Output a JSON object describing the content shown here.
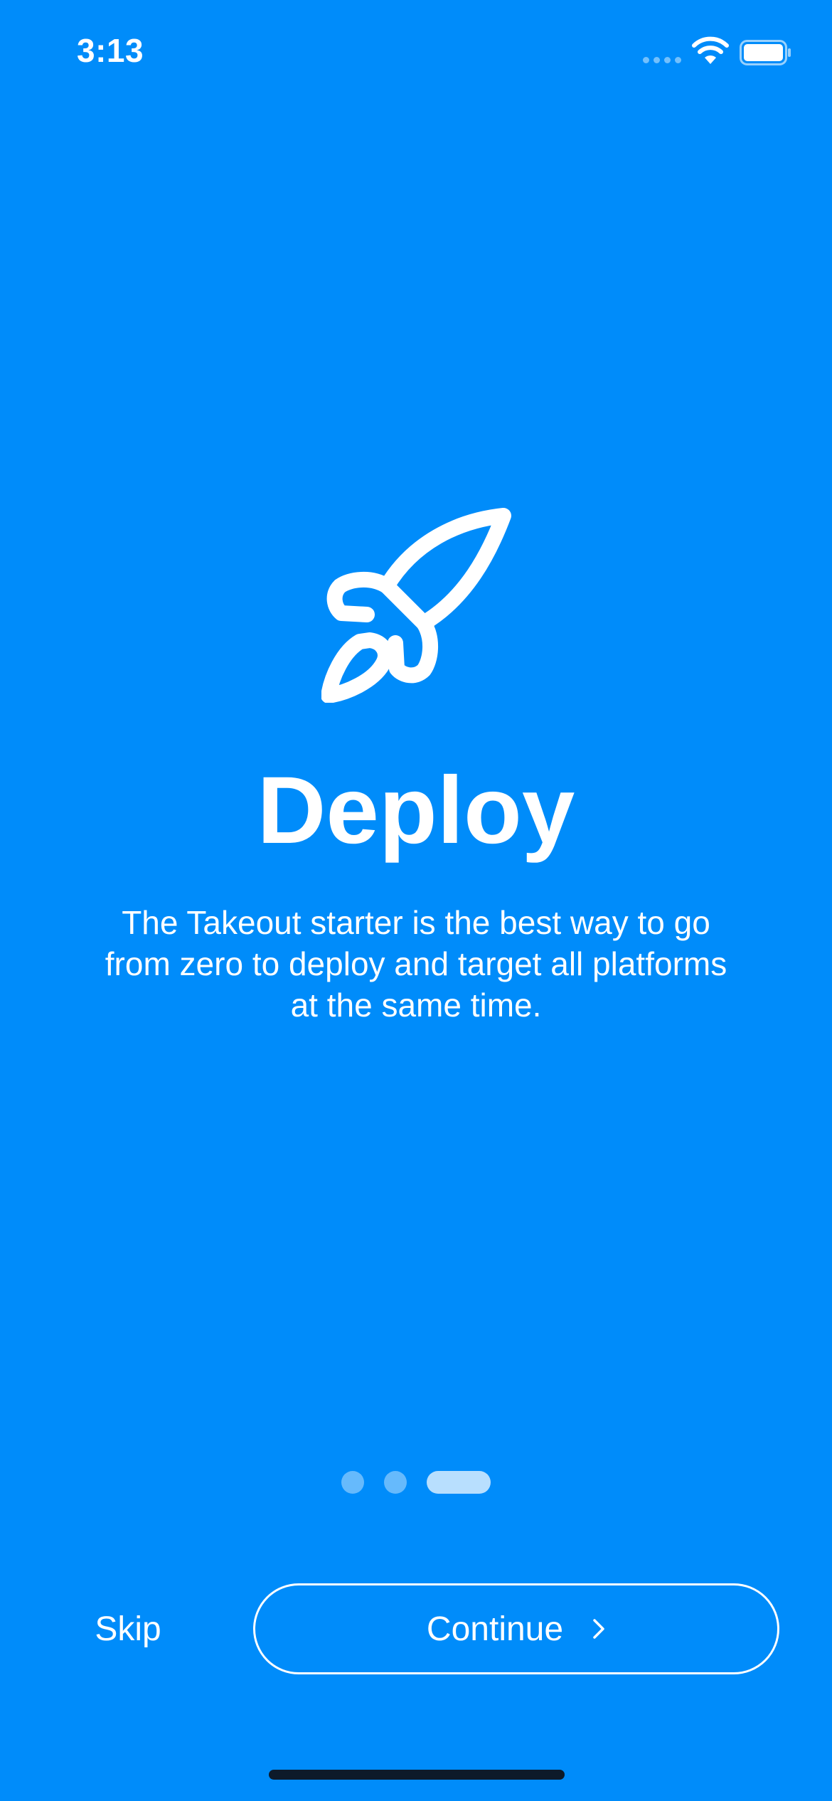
{
  "status_bar": {
    "time": "3:13",
    "icons": [
      "cellular-signal-icon",
      "wifi-icon",
      "battery-icon"
    ]
  },
  "onboarding": {
    "icon": "rocket-icon",
    "title": "Deploy",
    "description": "The Takeout starter is the best way to go from zero to deploy and target all platforms at the same time.",
    "page_count": 3,
    "current_page": 3
  },
  "actions": {
    "skip_label": "Skip",
    "continue_label": "Continue",
    "continue_icon": "chevron-right-icon"
  },
  "colors": {
    "background": "#008CFA",
    "foreground": "#FFFFFF"
  }
}
